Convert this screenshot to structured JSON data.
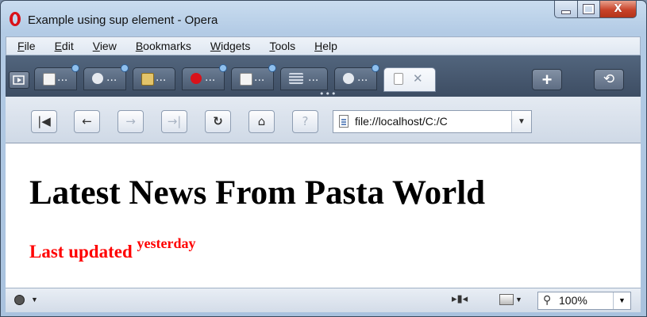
{
  "window": {
    "title": "Example using sup element - Opera"
  },
  "menu": [
    "File",
    "Edit",
    "View",
    "Bookmarks",
    "Widgets",
    "Tools",
    "Help"
  ],
  "tabs": [
    {
      "icon": "document-icon",
      "label": "...",
      "has_dot": true
    },
    {
      "icon": "speech-bubble-icon",
      "label": "...",
      "has_dot": true
    },
    {
      "icon": "download-icon",
      "label": "...",
      "has_dot": false
    },
    {
      "icon": "opera-icon",
      "label": "...",
      "has_dot": true
    },
    {
      "icon": "document-icon",
      "label": "...",
      "has_dot": true
    },
    {
      "icon": "grid-icon",
      "label": "...",
      "has_dot": false
    },
    {
      "icon": "speech-bubble-icon",
      "label": "...",
      "has_dot": true
    },
    {
      "icon": "page-icon",
      "label": "",
      "has_dot": false,
      "active": true
    }
  ],
  "tabbar": {
    "close_glyph": "✕",
    "new_tab_glyph": "+",
    "trash_glyph": "⟲",
    "overflow": "•••"
  },
  "nav": {
    "buttons": [
      "|◀",
      "←",
      "→",
      "→|",
      "↻",
      "⌂",
      "?"
    ],
    "address": "file://localhost/C:/C"
  },
  "page": {
    "heading": "Latest News From Pasta World",
    "updated_label": "Last updated",
    "updated_sup": "yesterday"
  },
  "status": {
    "zoom": "100%"
  },
  "colors": {
    "heading": "#000000",
    "updated": "#ff0000"
  }
}
